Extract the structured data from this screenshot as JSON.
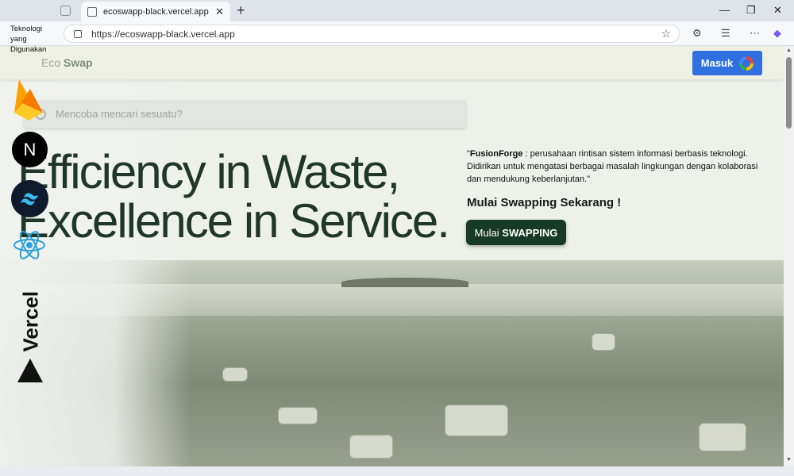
{
  "browser": {
    "tab_title": "ecoswapp-black.vercel.app",
    "url": "https://ecoswapp-black.vercel.app"
  },
  "navbar": {
    "logo_light": "Eco",
    "logo_bold": "Swap",
    "login_label": "Masuk"
  },
  "search": {
    "placeholder": "Mencoba mencari sesuatu?"
  },
  "hero": {
    "headline_line1": "Efficiency in Waste,",
    "headline_line2": "Excellence in Service.",
    "desc_company": "FusionForge",
    "desc_rest": " : perusahaan rintisan sistem informasi berbasis teknologi. Didirikan untuk mengatasi berbagai masalah lingkungan dengan kolaborasi dan mendukung keberlanjutan.",
    "cta_title": "Mulai Swapping Sekarang !",
    "cta_button_prefix": "Mulai ",
    "cta_button_bold": "SWAPPING"
  },
  "tech_overlay": {
    "label": "Teknologi yang Digunakan",
    "next_letter": "N",
    "vercel_word": "Vercel",
    "icons": [
      "firebase-icon",
      "nextjs-icon",
      "tailwind-icon",
      "react-icon",
      "vercel-icon"
    ]
  },
  "colors": {
    "accent": "#2f6fe0",
    "cta_bg": "#163a26",
    "headline": "#1f3628"
  }
}
